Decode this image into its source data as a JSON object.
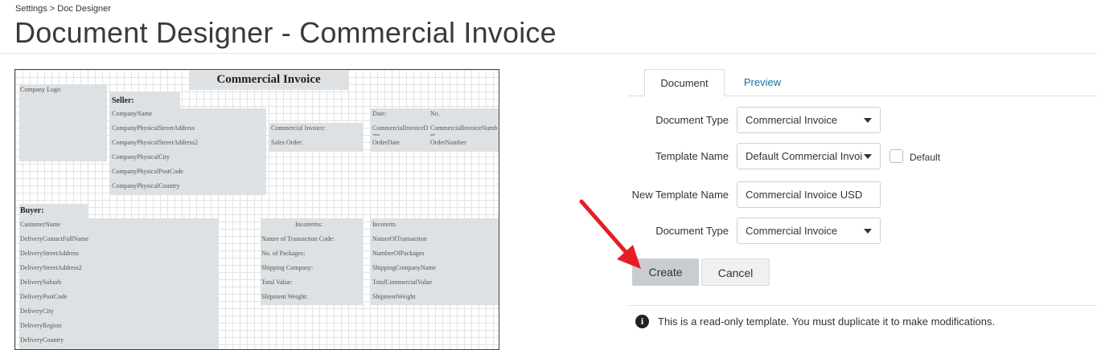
{
  "breadcrumb": "Settings > Doc Designer",
  "page_title": "Document Designer - Commercial Invoice",
  "canvas": {
    "doc_title": "Commercial Invoice",
    "company_logo": "Company Logo",
    "seller_header": "Seller:",
    "seller_fields": [
      "CompanyName",
      "CompanyPhysicalStreetAddress",
      "CompanyPhysicalStreetAddress2",
      "CompanyPhysicalCity",
      "CompanyPhysicalPostCode",
      "CompanyPhysicalCountry"
    ],
    "invoice_labels": [
      "Commercial Invoice:",
      "Sales Order:"
    ],
    "date_label": "Date:",
    "no_label": "No.",
    "date_values": [
      "CommercialInvoiceDate",
      "OrderDate"
    ],
    "no_values": [
      "CommercialInvoiceNumber",
      "OrderNumber"
    ],
    "buyer_header": "Buyer:",
    "buyer_fields": [
      "CustomerName",
      "DeliveryContactFullName",
      "DeliveryStreetAddress",
      "DeliveryStreetAddress2",
      "DeliverySuburb",
      "DeliveryPostCode",
      "DeliveryCity",
      "DeliveryRegion",
      "DeliveryCountry"
    ],
    "incoterms_label": "Incoterms:",
    "shipping_labels": [
      "Nature of Transaction Code:",
      "No. of Packages:",
      "Shipping Company:",
      "Total Value:",
      "Shipment Weight:"
    ],
    "shipping_values": [
      "Incoterm",
      "NatureOfTransaction",
      "NumberOfPackages",
      "ShippingCompanyName",
      "TotalCommercialValue",
      "ShipmentWeight"
    ]
  },
  "tabs": [
    {
      "label": "Document",
      "active": true
    },
    {
      "label": "Preview",
      "active": false
    }
  ],
  "form": {
    "document_type_label": "Document Type",
    "document_type_value": "Commercial Invoice",
    "template_name_label": "Template Name",
    "template_name_value": "Default Commercial Invoice",
    "default_label": "Default",
    "default_checked": false,
    "new_template_label": "New Template Name",
    "new_template_value": "Commercial Invoice USD",
    "document_type2_label": "Document Type",
    "document_type2_value": "Commercial Invoice"
  },
  "buttons": {
    "create": "Create",
    "cancel": "Cancel"
  },
  "notice": "This is a read-only template. You must duplicate it to make modifications.",
  "colors": {
    "arrow": "#e31e24",
    "tab_link": "#1a6fa3",
    "create_bg": "#c8cdd2",
    "field_block": "#dde1e3"
  }
}
